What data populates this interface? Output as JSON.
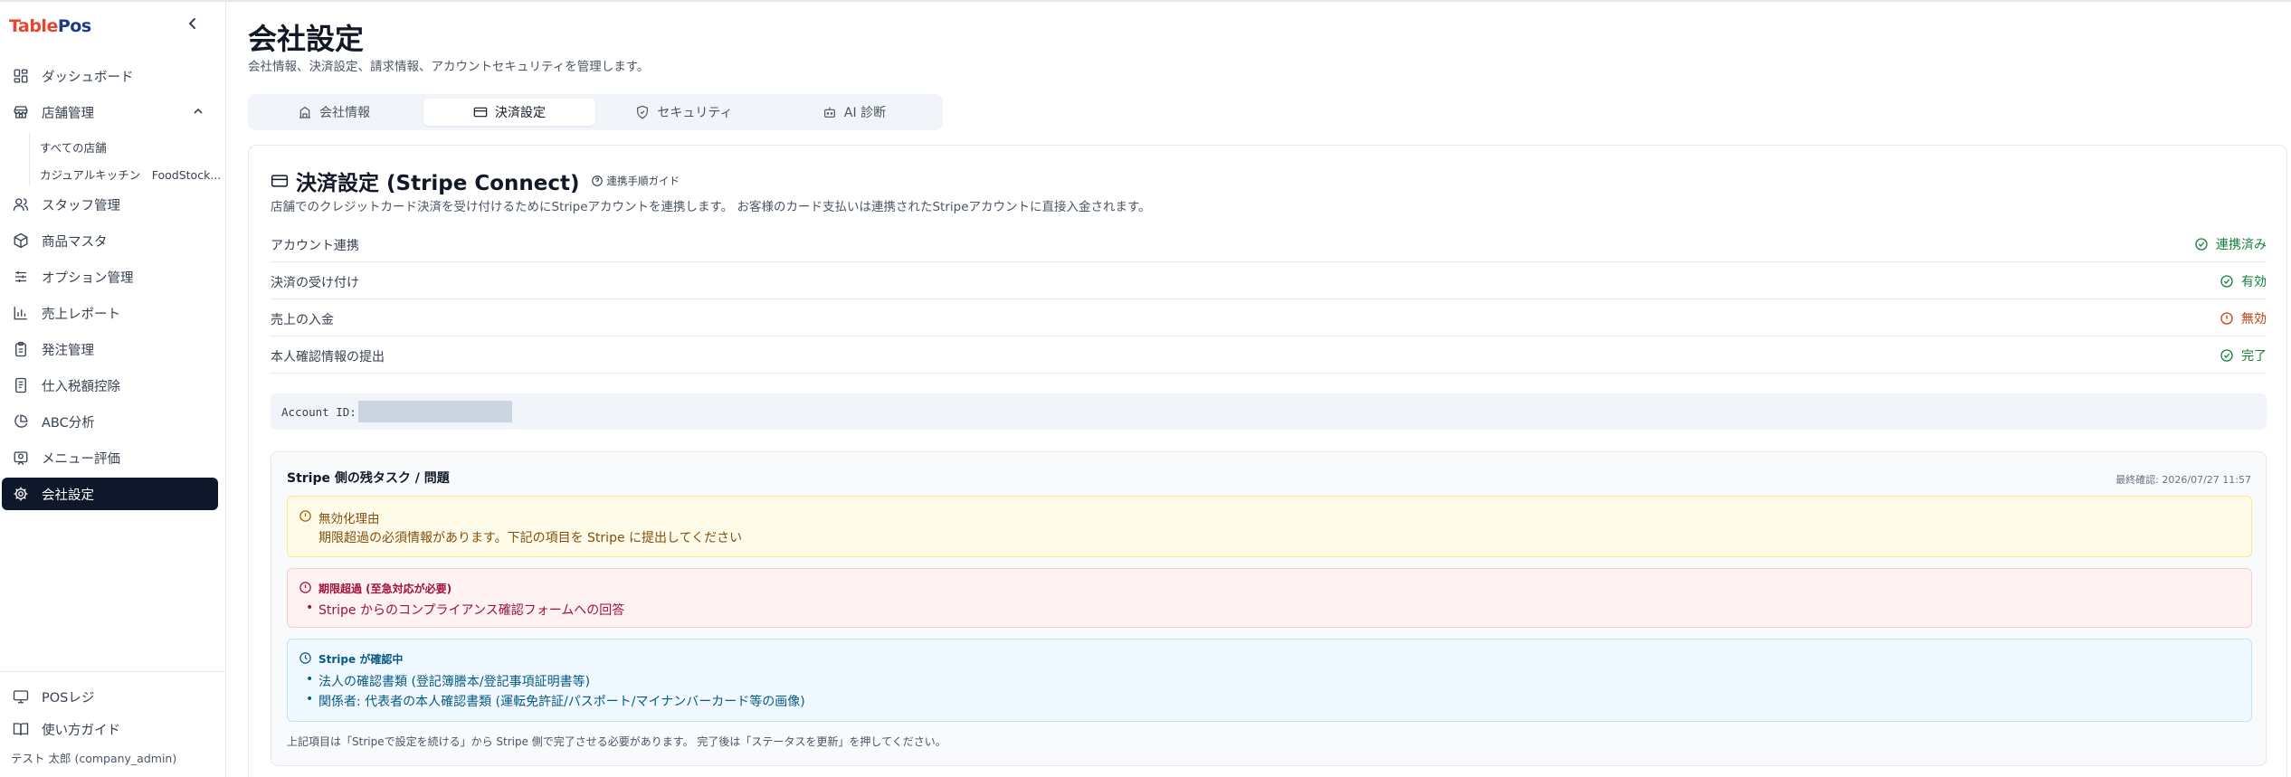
{
  "app": {
    "logo_part1": "Table",
    "logo_part2": "Pos"
  },
  "sidebar": {
    "collapse": "‹",
    "items": [
      {
        "label": "ダッシュボード"
      },
      {
        "label": "店舗管理"
      },
      {
        "label": "スタッフ管理"
      },
      {
        "label": "商品マスタ"
      },
      {
        "label": "オプション管理"
      },
      {
        "label": "売上レポート"
      },
      {
        "label": "発注管理"
      },
      {
        "label": "仕入税額控除"
      },
      {
        "label": "ABC分析"
      },
      {
        "label": "メニュー評価"
      },
      {
        "label": "会社設定"
      }
    ],
    "sub_items": [
      {
        "label": "すべての店舗"
      },
      {
        "label": "カジュアルキッチン　FoodStock..."
      }
    ],
    "bottom_items": [
      {
        "label": "POSレジ"
      },
      {
        "label": "使い方ガイド"
      }
    ],
    "user": "テスト 太郎 (company_admin)"
  },
  "page": {
    "title": "会社設定",
    "subtitle": "会社情報、決済設定、請求情報、アカウントセキュリティを管理します。"
  },
  "tabs": [
    {
      "label": "会社情報"
    },
    {
      "label": "決済設定"
    },
    {
      "label": "セキュリティ"
    },
    {
      "label": "AI 診断"
    }
  ],
  "payment": {
    "title": "決済設定 (Stripe Connect)",
    "guide": "連携手順ガイド",
    "description": "店舗でのクレジットカード決済を受け付けるためにStripeアカウントを連携します。 お客様のカード支払いは連携されたStripeアカウントに直接入金されます。",
    "rows": [
      {
        "label": "アカウント連携",
        "status": "連携済み"
      },
      {
        "label": "決済の受け付け",
        "status": "有効"
      },
      {
        "label": "売上の入金",
        "status": "無効"
      },
      {
        "label": "本人確認情報の提出",
        "status": "完了"
      }
    ],
    "account_id_label": "Account ID:"
  },
  "tasks": {
    "title": "Stripe 側の残タスク / 問題",
    "last_checked": "最終確認: 2026/07/27 11:57",
    "disabled_heading": "無効化理由",
    "disabled_text": "期限超過の必須情報があります。下記の項目を Stripe に提出してください",
    "overdue_heading": "期限超過 (至急対応が必要)",
    "overdue_items": [
      "Stripe からのコンプライアンス確認フォームへの回答"
    ],
    "pending_heading": "Stripe が確認中",
    "pending_items": [
      "法人の確認書類 (登記簿謄本/登記事項証明書等)",
      "関係者: 代表者の本人確認書類 (運転免許証/パスポート/マイナンバーカード等の画像)"
    ],
    "note": "上記項目は「Stripeで設定を続ける」から Stripe 側で完了させる必要があります。 完了後は「ステータスを更新」を押してください。"
  },
  "colors": {
    "ok": "#15803d",
    "warn": "#c2410c",
    "active_nav": "#0f172a"
  }
}
